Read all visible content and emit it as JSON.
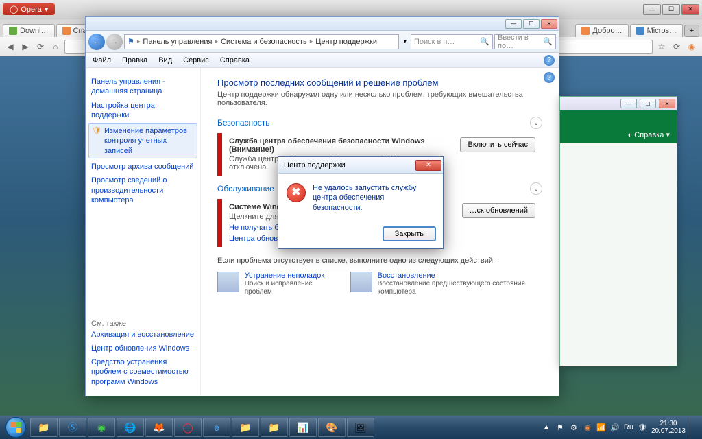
{
  "opera": {
    "label": "Opera"
  },
  "browserTabs": [
    {
      "label": "Downl…",
      "icon": "#6a4"
    },
    {
      "label": "Спасиб…",
      "icon": "#e84"
    },
    {
      "label": "",
      "icon": "#48c"
    },
    {
      "label": "Добро…",
      "icon": "#e84"
    },
    {
      "label": "Micros…",
      "icon": "#48c"
    }
  ],
  "breadcrumb": {
    "root": "Панель управления",
    "mid": "Система и безопасность",
    "leaf": "Центр поддержки",
    "searchPlaceholder": "Поиск в п…",
    "secondarySearch": "Ввести в по…"
  },
  "menubar": [
    "Файл",
    "Правка",
    "Вид",
    "Сервис",
    "Справка"
  ],
  "sidebar": {
    "links": [
      "Панель управления - домашняя страница",
      "Настройка центра поддержки",
      "Изменение параметров контроля учетных записей",
      "Просмотр архива сообщений",
      "Просмотр сведений о производительности компьютера"
    ],
    "seeAlso": "См. также",
    "seeAlsoLinks": [
      "Архивация и восстановление",
      "Центр обновления Windows",
      "Средство устранения проблем с совместимостью программ Windows"
    ]
  },
  "main": {
    "title": "Просмотр последних сообщений и решение проблем",
    "subtitle": "Центр поддержки обнаружил одну или несколько проблем, требующих вмешательства пользователя.",
    "security": {
      "heading": "Безопасность",
      "issueTitle": "Служба центра обеспечения безопасности Windows  (Внимание!)",
      "issueDesc": "Служба центра обеспечения безопасности Windows отключена.",
      "button": "Включить сейчас"
    },
    "maintenance": {
      "heading": "Обслуживание",
      "issueTitle": "Системе Windo… автоматич… (Внимание!)",
      "issueDesc": "Щелкните для п…",
      "link1": "Не получать бо…",
      "link2": "Центра обновле…",
      "button": "…ск обновлений"
    },
    "bottomNote": "Если проблема отсутствует в списке, выполните одно из следующих действий:",
    "action1": {
      "title": "Устранение неполадок",
      "desc": "Поиск и исправление проблем"
    },
    "action2": {
      "title": "Восстановление",
      "desc": "Восстановление предшествующего состояния компьютера"
    }
  },
  "modal": {
    "title": "Центр поддержки",
    "message": "Не удалось запустить службу центра обеспечения безопасности.",
    "close": "Закрыть"
  },
  "rightWin": {
    "help": "Справка ▾"
  },
  "tray": {
    "time": "21:30",
    "date": "20.07.2013",
    "lang": "Ru"
  }
}
